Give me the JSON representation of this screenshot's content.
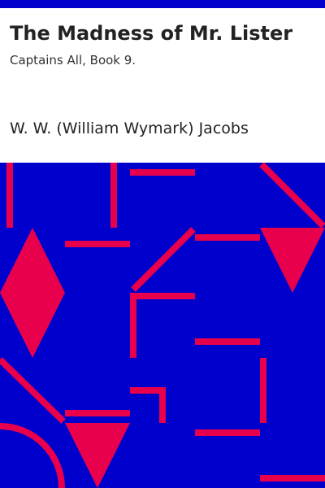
{
  "cover": {
    "title": "The Madness of Mr. Lister",
    "subtitle": "Captains All, Book 9.",
    "author": "W. W. (William Wymark) Jacobs"
  },
  "colors": {
    "band": "#0000cc",
    "background": "#ffffff",
    "pattern_fill": "#0000cc",
    "pattern_stroke": "#e8004c",
    "title_text": "#222222"
  }
}
